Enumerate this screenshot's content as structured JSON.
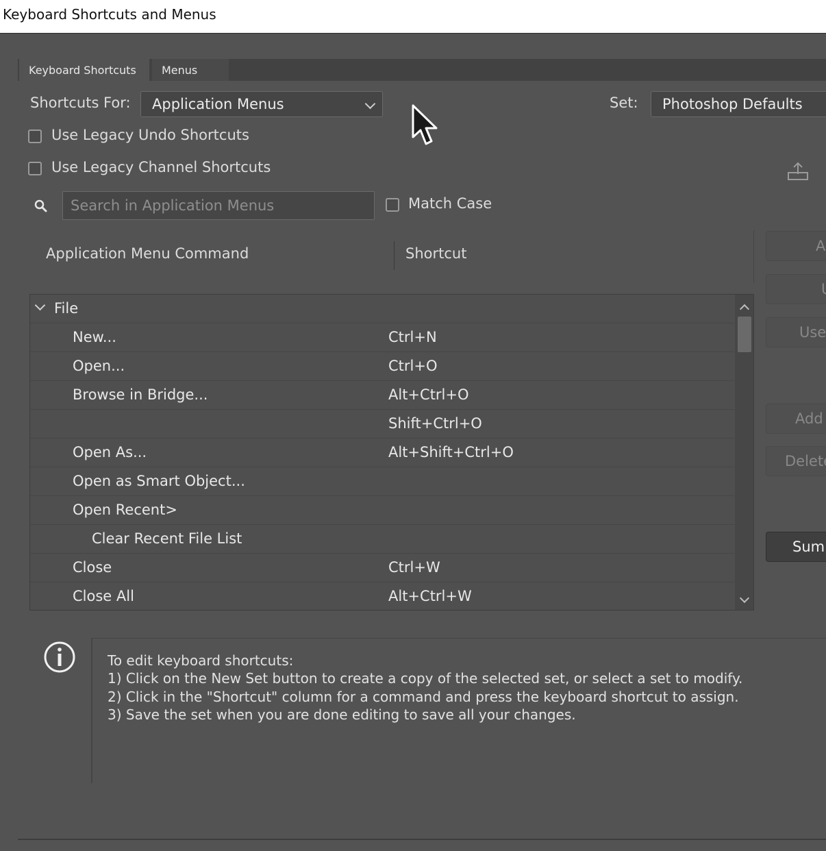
{
  "window": {
    "title": "Keyboard Shortcuts and Menus"
  },
  "tabs": [
    {
      "label": "Keyboard Shortcuts",
      "active": true
    },
    {
      "label": "Menus",
      "active": false
    }
  ],
  "shortcuts_for": {
    "label": "Shortcuts For:",
    "value": "Application Menus"
  },
  "set": {
    "label": "Set:",
    "value": "Photoshop Defaults"
  },
  "options": {
    "legacy_undo": {
      "label": "Use Legacy Undo Shortcuts",
      "checked": false
    },
    "legacy_channel": {
      "label": "Use Legacy Channel Shortcuts",
      "checked": false
    },
    "match_case": {
      "label": "Match Case",
      "checked": false
    }
  },
  "search": {
    "placeholder": "Search in Application Menus",
    "value": ""
  },
  "table": {
    "columns": [
      "Application Menu Command",
      "Shortcut"
    ],
    "group": {
      "label": "File",
      "expanded": true
    },
    "rows": [
      {
        "command": "New...",
        "shortcut": "Ctrl+N",
        "indent": 1
      },
      {
        "command": "Open...",
        "shortcut": "Ctrl+O",
        "indent": 1
      },
      {
        "command": "Browse in Bridge...",
        "shortcut": "Alt+Ctrl+O",
        "indent": 1
      },
      {
        "command": "",
        "shortcut": "Shift+Ctrl+O",
        "indent": 1
      },
      {
        "command": "Open As...",
        "shortcut": "Alt+Shift+Ctrl+O",
        "indent": 1
      },
      {
        "command": "Open as Smart Object...",
        "shortcut": "",
        "indent": 1
      },
      {
        "command": "Open Recent>",
        "shortcut": "",
        "indent": 1
      },
      {
        "command": "Clear Recent File List",
        "shortcut": "",
        "indent": 2
      },
      {
        "command": "Close",
        "shortcut": "Ctrl+W",
        "indent": 1
      },
      {
        "command": "Close All",
        "shortcut": "Alt+Ctrl+W",
        "indent": 1
      }
    ]
  },
  "side_buttons": [
    {
      "label": "A",
      "enabled": false
    },
    {
      "label": "U",
      "enabled": false
    },
    {
      "label": "Use",
      "enabled": false
    },
    {
      "label": "Add",
      "enabled": false
    },
    {
      "label": "Delete",
      "enabled": false
    },
    {
      "label": "Summ",
      "enabled": true
    }
  ],
  "info": {
    "lines": [
      "To edit keyboard shortcuts:",
      "1) Click on the New Set button to create a copy of the selected set, or select a set to modify.",
      "2) Click in the \"Shortcut\" column for a command and press the keyboard shortcut to assign.",
      "3) Save the set when you are done editing to save all your changes."
    ]
  }
}
